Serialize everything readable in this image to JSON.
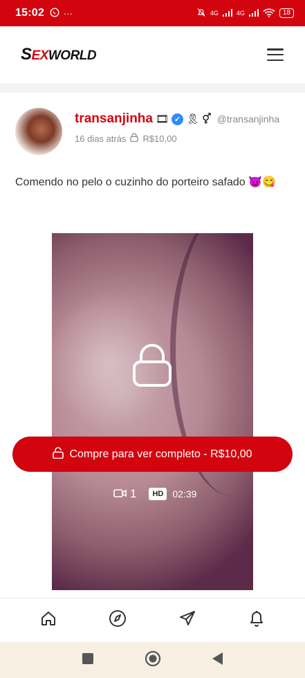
{
  "status_bar": {
    "time": "15:02",
    "network_1": "4G",
    "network_2": "4G",
    "battery": "18"
  },
  "header": {
    "logo_s": "S",
    "logo_text_red": "EX",
    "logo_text_dark": "WORLD"
  },
  "post": {
    "username": "transanjinha",
    "badges": [
      "🎞",
      "🎗",
      "⚥"
    ],
    "handle": "@transanjinha",
    "time_ago": "16 dias atrás",
    "price": "R$10,00",
    "text": "Comendo no pelo o cuzinho do porteiro safado 😈😋"
  },
  "media": {
    "buy_label": "Compre para ver completo - R$10,00",
    "video_count": "1",
    "quality": "HD",
    "duration": "02:39"
  },
  "colors": {
    "brand_red": "#d2050f",
    "verified_blue": "#2f8cff"
  },
  "bottom_nav": {
    "items": [
      "home-icon",
      "compass-icon",
      "send-icon",
      "bell-icon"
    ]
  }
}
